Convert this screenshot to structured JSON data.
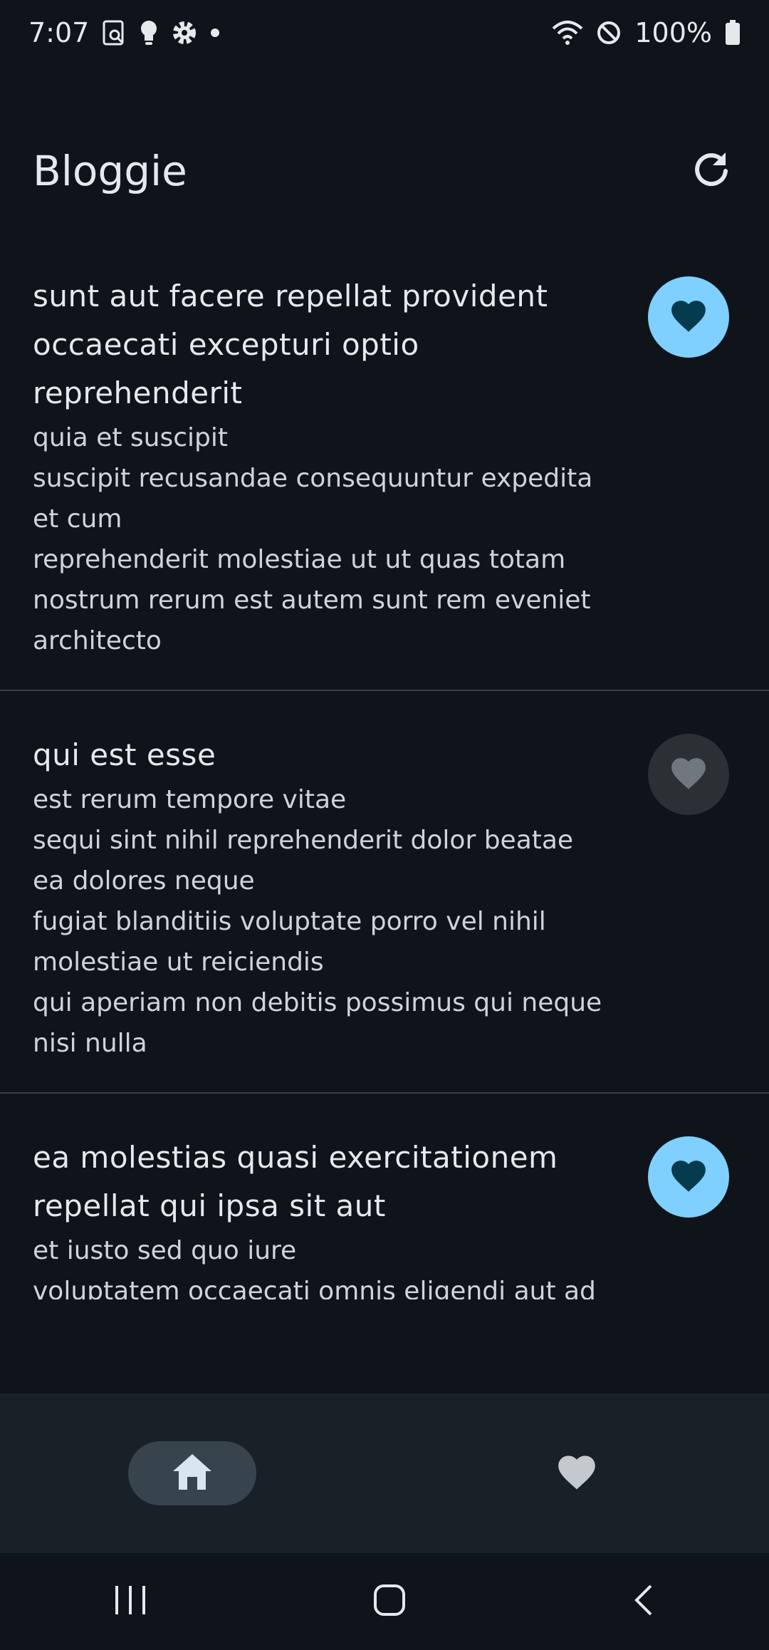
{
  "status_bar": {
    "time": "7:07",
    "battery": "100%"
  },
  "app": {
    "title": "Bloggie"
  },
  "posts": [
    {
      "title": "sunt aut facere repellat provident occaecati excepturi optio reprehenderit",
      "body": "quia et suscipit\nsuscipit recusandae consequuntur expedita et cum\nreprehenderit molestiae ut ut quas totam\nnostrum rerum est autem sunt rem eveniet architecto",
      "favorited": true
    },
    {
      "title": "qui est esse",
      "body": "est rerum tempore vitae\nsequi sint nihil reprehenderit dolor beatae ea dolores neque\nfugiat blanditiis voluptate porro vel nihil molestiae ut reiciendis\nqui aperiam non debitis possimus qui neque nisi nulla",
      "favorited": false
    },
    {
      "title": "ea molestias quasi exercitationem repellat qui ipsa sit aut",
      "body": "et iusto sed quo iure\nvoluptatem occaecati omnis eligendi aut ad\nvoluptatem doloribus vel accusantium quis pariatur",
      "favorited": true
    }
  ],
  "bottom_nav": [
    {
      "icon": "home-icon",
      "active": true
    },
    {
      "icon": "heart-icon",
      "active": false
    }
  ],
  "colors": {
    "background": "#0f141a",
    "accent": "#7fd0ff",
    "nav_bar": "#182127"
  }
}
